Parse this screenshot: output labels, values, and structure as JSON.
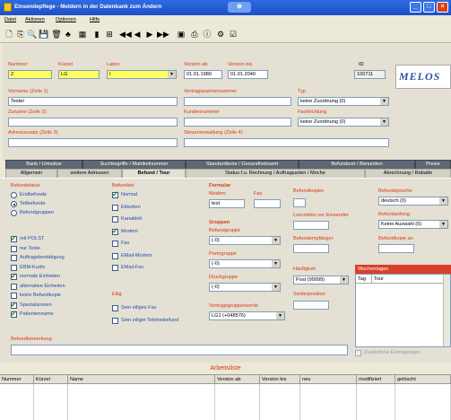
{
  "window": {
    "title": "Einsendepflege - Meldern in der Datenbank zum Ändern",
    "badge": "⊕",
    "min": "_",
    "max": "□",
    "close": "×"
  },
  "menu": [
    "Datei",
    "Aktionen",
    "Optionen",
    "Hilfe"
  ],
  "toolbar_icons": [
    "new-doc-icon",
    "copy-icon",
    "search-icon",
    "save-icon",
    "delete-icon",
    "filter-icon",
    "print-icon",
    "chart-icon",
    "grid-icon",
    "nav-first-icon",
    "nav-prev-icon",
    "nav-next-icon",
    "nav-last-icon",
    "pdf-icon",
    "print2-icon",
    "info-icon",
    "tools-icon",
    "check-icon"
  ],
  "toolbar_glyphs": [
    "🗋",
    "⎘",
    "🔍",
    "💾",
    "🗑",
    "♣",
    "▦",
    "▮",
    "⊞",
    "◀◀",
    "◀",
    "▶",
    "▶▶",
    "▣",
    "⎙",
    "ⓘ",
    "⚙",
    "☑"
  ],
  "header": {
    "nummer_label": "Nummer",
    "nummer": "2",
    "kuerzel_label": "Kürzel",
    "kuerzel": "LG",
    "labor_label": "Labor",
    "labor": "I",
    "version_ab_label": "Version ab",
    "version_ab": "01.01.1980",
    "version_bis_label": "Version bis",
    "version_bis": "01.01.2040",
    "id_label": "ID",
    "id": "100711",
    "logo": "MELOS",
    "vorname_label": "Vorname (Zeile 1)",
    "vorname": "Tester",
    "vertrag_label": "Vertragspartnernummer",
    "vertrag": "",
    "typ_label": "Typ",
    "typ": "keine Zuordnung (0)",
    "zuname_label": "Zuname (Zeile 2)",
    "zuname": "",
    "kunden_label": "Kundennummer",
    "kunden": "",
    "fachrichtung_label": "Fachrichtung",
    "fachrichtung": "keine Zuordnung (0)",
    "adress_label": "Adresszusatz (Zeile 3)",
    "adress": "",
    "steuer_label": "Steuerverwaltung (Zeile 4)",
    "steuer": ""
  },
  "tabs_row1": [
    "Bank / Umsätze",
    "Suchbegriffe / Matrikelnummer",
    "Standardtexte / Gesundheitsamt",
    "Befundsort / Benunden",
    "Preise"
  ],
  "tabs_row2": [
    "Allgemein",
    "weitere Adressen",
    "Befund / Tour",
    "Status f.u. Rechnung / Auftragsarten / Moche",
    "Abrechnung / Rabatte"
  ],
  "befundstatus": {
    "title": "Befundstatus",
    "radios": [
      {
        "label": "Endbefunde",
        "on": false
      },
      {
        "label": "Teilbefunde",
        "on": true
      },
      {
        "label": "Befundgruppen",
        "on": false
      }
    ],
    "checks": [
      {
        "label": "mit POLST",
        "on": true
      },
      {
        "label": "nur Teste",
        "on": false
      },
      {
        "label": "Auftragsbestätigung",
        "on": false
      },
      {
        "label": "EBM-Kurtiv",
        "on": false
      },
      {
        "label": "normale Einheiten",
        "on": true
      },
      {
        "label": "alternative Einheiten",
        "on": false
      },
      {
        "label": "keine Befundkopie",
        "on": false
      },
      {
        "label": "Spezialanreen",
        "on": true
      },
      {
        "label": "Patientenname",
        "on": true
      }
    ]
  },
  "befundart": {
    "title": "Befundart",
    "checks": [
      {
        "label": "Normal",
        "on": true
      },
      {
        "label": "Etiketten",
        "on": false
      },
      {
        "label": "Kanaldoh",
        "on": false
      },
      {
        "label": "Modem",
        "on": true
      },
      {
        "label": "Fax",
        "on": false
      },
      {
        "label": "EMail-Modem",
        "on": false
      },
      {
        "label": "EMail-Fax",
        "on": false
      }
    ],
    "eilig_title": "Eilig",
    "eilig": [
      {
        "label": "Sein eiliges Fax",
        "on": false
      },
      {
        "label": "Sein eiliger Telefonbefund",
        "on": false
      }
    ]
  },
  "formular": {
    "title": "Formular",
    "modem_label": "Modem",
    "modem": "test",
    "fax_label": "Fax",
    "fax": ""
  },
  "gruppen": {
    "title": "Gruppen",
    "befund_label": "Befundgruppe",
    "befund": "(-0)",
    "porto_label": "Portogruppe",
    "porto": "(-0)",
    "druck_label": "Druckgruppe",
    "druck": "(-0)",
    "vertrag_label": "Vertragsgruppensortie",
    "vertrag": "LG1 (+048576)"
  },
  "mid": {
    "kopien_label": "Befundkopien",
    "kopien": "",
    "zeilen_label": "Leerzeilen vor Einsender",
    "zeilen": "",
    "anfaenger_label": "Befundempfänger",
    "anfaenger": "",
    "haeufigkeit_label": "Häufigkeit",
    "haeufigkeit": "Post (99999)",
    "sortier_label": "Sortierposition",
    "sortier": ""
  },
  "right": {
    "sprache_label": "Befundsprache",
    "sprache": "deutsch (0)",
    "anfang_label": "Befundanfang",
    "anfang": "Keine Auswahl (0)",
    "kopie_label": "Befundkopie an",
    "kopie": "",
    "wochen_label": "Wochentagen",
    "col_tag": "Tag",
    "col_tour": "Tour",
    "footer_check": "Zusätzliche Eintragungen"
  },
  "bemerkung_label": "Befundbemerkung",
  "bemerkung": "",
  "grid": {
    "title": "Arbeitsliste",
    "columns": [
      "Nummer",
      "Kürzel",
      "Name",
      "Version ab",
      "Version bis",
      "neu",
      "modifiziert",
      "gelöscht"
    ]
  },
  "colors": {
    "label": "#d63a10",
    "title": "#1d4fc8",
    "yellow": "#ffff60"
  }
}
